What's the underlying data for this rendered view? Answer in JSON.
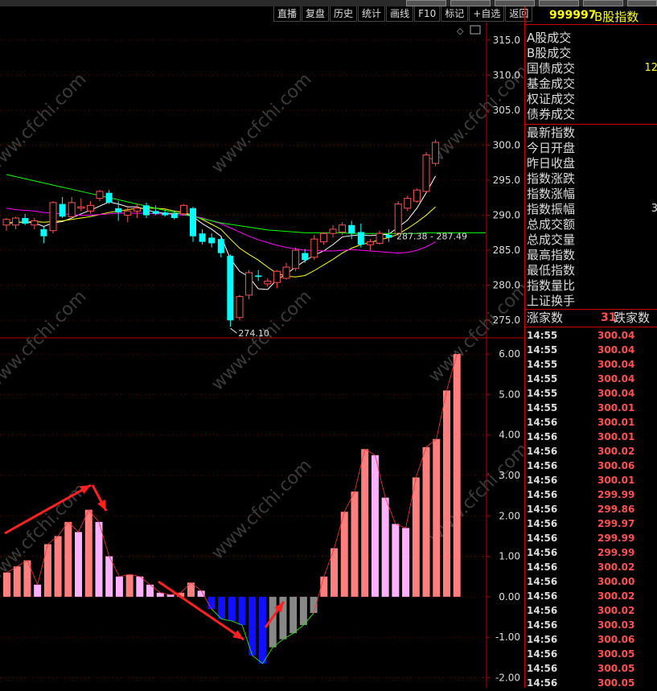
{
  "toolbar": {
    "buttons": [
      "直播",
      "复盘",
      "历史",
      "统计",
      "画线",
      "F10",
      "标记",
      "+自选",
      "返回"
    ]
  },
  "panel": {
    "code": "999997",
    "name": "B股指数",
    "volume_rows": [
      "A股成交",
      "B股成交",
      "国债成交",
      "基金成交",
      "权证成交",
      "债券成交"
    ],
    "volume_partial_values": [
      "",
      "",
      "12",
      "",
      "",
      ""
    ],
    "index_rows": [
      "最新指数",
      "今日开盘",
      "昨日收盘",
      "指数涨跌",
      "指数涨幅",
      "指数振幅",
      "总成交额",
      "总成交量",
      "最高指数",
      "最低指数",
      "指数量比",
      "上证换手"
    ],
    "index_partial_values": [
      "",
      "",
      "",
      "",
      "",
      "3",
      "",
      "",
      "",
      "",
      "",
      ""
    ],
    "up_label": "涨家数",
    "up_count": "31",
    "down_label": "跌家数",
    "ticks": [
      {
        "time": "14:55",
        "price": "300.04"
      },
      {
        "time": "14:55",
        "price": "300.04"
      },
      {
        "time": "14:55",
        "price": "300.04"
      },
      {
        "time": "14:55",
        "price": "300.04"
      },
      {
        "time": "14:55",
        "price": "300.04"
      },
      {
        "time": "14:55",
        "price": "300.01"
      },
      {
        "time": "14:56",
        "price": "300.01"
      },
      {
        "time": "14:56",
        "price": "300.01"
      },
      {
        "time": "14:56",
        "price": "300.02"
      },
      {
        "time": "14:56",
        "price": "300.06"
      },
      {
        "time": "14:56",
        "price": "300.01"
      },
      {
        "time": "14:56",
        "price": "299.99"
      },
      {
        "time": "14:56",
        "price": "299.86"
      },
      {
        "time": "14:56",
        "price": "299.97"
      },
      {
        "time": "14:56",
        "price": "299.99"
      },
      {
        "time": "14:56",
        "price": "299.99"
      },
      {
        "time": "14:56",
        "price": "300.02"
      },
      {
        "time": "14:56",
        "price": "300.00"
      },
      {
        "time": "14:56",
        "price": "300.02"
      },
      {
        "time": "14:56",
        "price": "300.02"
      },
      {
        "time": "14:56",
        "price": "300.03"
      },
      {
        "time": "14:56",
        "price": "300.06"
      },
      {
        "time": "14:56",
        "price": "300.05"
      },
      {
        "time": "14:56",
        "price": "300.05"
      },
      {
        "time": "14:56",
        "price": "300.05"
      }
    ]
  },
  "watermark": "www.cfchi.com",
  "colors": {
    "up": "#ff5050",
    "down": "#00ffff",
    "axis": "#c00000",
    "ma5": "#ffffff",
    "ma10": "#ffff00",
    "ma20": "#ff00ff",
    "ma60": "#00ff00"
  },
  "chart_data": [
    {
      "type": "candlestick",
      "ylim": [
        272.5,
        317.5
      ],
      "yticks": [
        "315.0",
        "310.0",
        "305.0",
        "300.0",
        "295.0",
        "290.0",
        "285.0",
        "280.0",
        "275.0"
      ],
      "annotations": {
        "low_label": "274.10",
        "range_label": "287.38 - 287.49"
      },
      "candles": [
        {
          "o": 288.6,
          "h": 289.6,
          "l": 287.8,
          "c": 289.4
        },
        {
          "o": 288.6,
          "h": 289.8,
          "l": 288.0,
          "c": 289.6
        },
        {
          "o": 289.6,
          "h": 290.2,
          "l": 288.6,
          "c": 288.8
        },
        {
          "o": 288.6,
          "h": 289.6,
          "l": 288.0,
          "c": 289.2
        },
        {
          "o": 288.0,
          "h": 288.4,
          "l": 286.0,
          "c": 287.0
        },
        {
          "o": 287.8,
          "h": 292.0,
          "l": 287.4,
          "c": 291.8
        },
        {
          "o": 291.6,
          "h": 292.6,
          "l": 289.6,
          "c": 289.8
        },
        {
          "o": 289.8,
          "h": 292.6,
          "l": 289.6,
          "c": 291.8
        },
        {
          "o": 291.0,
          "h": 292.4,
          "l": 290.6,
          "c": 291.2
        },
        {
          "o": 290.6,
          "h": 292.0,
          "l": 290.2,
          "c": 291.4
        },
        {
          "o": 292.4,
          "h": 293.6,
          "l": 292.0,
          "c": 293.4
        },
        {
          "o": 293.2,
          "h": 293.6,
          "l": 291.6,
          "c": 291.8
        },
        {
          "o": 291.0,
          "h": 292.0,
          "l": 289.2,
          "c": 290.4
        },
        {
          "o": 290.0,
          "h": 291.2,
          "l": 289.0,
          "c": 290.6
        },
        {
          "o": 290.6,
          "h": 291.6,
          "l": 289.6,
          "c": 291.0
        },
        {
          "o": 291.4,
          "h": 291.8,
          "l": 289.6,
          "c": 290.0
        },
        {
          "o": 290.6,
          "h": 291.4,
          "l": 290.0,
          "c": 290.2
        },
        {
          "o": 290.4,
          "h": 290.8,
          "l": 289.8,
          "c": 290.0
        },
        {
          "o": 290.2,
          "h": 290.6,
          "l": 289.4,
          "c": 289.6
        },
        {
          "o": 290.2,
          "h": 291.6,
          "l": 290.0,
          "c": 291.4
        },
        {
          "o": 291.0,
          "h": 291.2,
          "l": 286.2,
          "c": 287.0
        },
        {
          "o": 287.4,
          "h": 288.0,
          "l": 285.8,
          "c": 286.2
        },
        {
          "o": 286.8,
          "h": 287.4,
          "l": 285.4,
          "c": 286.0
        },
        {
          "o": 286.6,
          "h": 286.8,
          "l": 284.0,
          "c": 284.6
        },
        {
          "o": 284.2,
          "h": 284.4,
          "l": 274.1,
          "c": 275.0
        },
        {
          "o": 275.4,
          "h": 278.6,
          "l": 275.0,
          "c": 278.4
        },
        {
          "o": 278.6,
          "h": 282.2,
          "l": 278.0,
          "c": 281.8
        },
        {
          "o": 281.4,
          "h": 282.2,
          "l": 280.6,
          "c": 281.2
        },
        {
          "o": 280.2,
          "h": 281.0,
          "l": 279.8,
          "c": 280.6
        },
        {
          "o": 280.4,
          "h": 282.2,
          "l": 279.6,
          "c": 282.0
        },
        {
          "o": 281.0,
          "h": 283.2,
          "l": 280.8,
          "c": 282.6
        },
        {
          "o": 282.4,
          "h": 285.4,
          "l": 282.0,
          "c": 285.0
        },
        {
          "o": 284.6,
          "h": 285.2,
          "l": 283.2,
          "c": 283.6
        },
        {
          "o": 284.0,
          "h": 287.2,
          "l": 283.6,
          "c": 286.6
        },
        {
          "o": 286.2,
          "h": 287.6,
          "l": 285.8,
          "c": 287.4
        },
        {
          "o": 287.4,
          "h": 288.6,
          "l": 286.8,
          "c": 288.0
        },
        {
          "o": 287.6,
          "h": 289.0,
          "l": 287.2,
          "c": 288.6
        },
        {
          "o": 288.6,
          "h": 289.2,
          "l": 286.6,
          "c": 287.4
        },
        {
          "o": 287.6,
          "h": 288.8,
          "l": 285.4,
          "c": 285.8
        },
        {
          "o": 285.8,
          "h": 286.6,
          "l": 285.0,
          "c": 286.2
        },
        {
          "o": 286.0,
          "h": 287.8,
          "l": 285.8,
          "c": 287.4
        },
        {
          "o": 287.2,
          "h": 288.0,
          "l": 286.2,
          "c": 286.8
        },
        {
          "o": 287.4,
          "h": 292.0,
          "l": 287.0,
          "c": 291.6
        },
        {
          "o": 291.0,
          "h": 292.8,
          "l": 290.6,
          "c": 292.4
        },
        {
          "o": 292.0,
          "h": 293.8,
          "l": 291.8,
          "c": 293.6
        },
        {
          "o": 293.4,
          "h": 299.0,
          "l": 293.2,
          "c": 298.6
        },
        {
          "o": 297.4,
          "h": 300.8,
          "l": 297.0,
          "c": 300.4
        }
      ],
      "ma_series": [
        {
          "values": [
            288.8,
            289.0,
            289.0,
            288.9,
            288.4,
            288.9,
            289.1,
            289.6,
            290.2,
            290.7,
            291.3,
            291.9,
            291.6,
            291.2,
            291.2,
            290.8,
            290.4,
            290.3,
            290.2,
            290.3,
            289.8,
            288.8,
            288.0,
            287.0,
            283.8,
            282.0,
            281.2,
            279.5,
            279.4,
            280.8,
            281.6,
            282.6,
            283.5,
            284.3,
            284.9,
            285.8,
            286.9,
            287.1,
            287.2,
            287.1,
            287.2,
            287.3,
            288.3,
            289.3,
            291.0,
            293.2,
            295.6
          ]
        },
        {
          "values": [
            288.9,
            289.0,
            289.0,
            289.1,
            289.0,
            289.1,
            289.2,
            289.4,
            289.6,
            289.8,
            290.1,
            290.4,
            290.6,
            290.8,
            291.0,
            291.0,
            291.0,
            290.9,
            290.6,
            290.4,
            290.0,
            289.4,
            288.7,
            288.0,
            286.6,
            285.3,
            284.4,
            283.6,
            282.6,
            281.7,
            281.3,
            281.2,
            281.4,
            282.1,
            282.9,
            283.7,
            284.6,
            285.3,
            285.8,
            286.1,
            286.5,
            286.8,
            287.3,
            288.1,
            289.0,
            290.0,
            291.2
          ]
        },
        {
          "values": [
            291.0,
            290.8,
            290.7,
            290.6,
            290.4,
            290.3,
            290.2,
            290.1,
            290.0,
            290.0,
            290.1,
            290.2,
            290.3,
            290.3,
            290.3,
            290.3,
            290.2,
            290.2,
            290.1,
            290.0,
            289.9,
            289.6,
            289.2,
            288.8,
            288.2,
            287.6,
            287.0,
            286.5,
            286.1,
            285.7,
            285.4,
            285.2,
            285.0,
            285.0,
            284.9,
            284.9,
            285.0,
            285.1,
            285.0,
            284.9,
            284.8,
            284.7,
            284.6,
            284.7,
            285.0,
            285.5,
            286.2
          ]
        },
        {
          "values": [
            295.8,
            295.5,
            295.2,
            294.9,
            294.6,
            294.3,
            294.0,
            293.7,
            293.4,
            293.1,
            292.8,
            292.5,
            292.2,
            291.9,
            291.6,
            291.3,
            291.0,
            290.7,
            290.4,
            290.1,
            289.8,
            289.5,
            289.2,
            288.9,
            288.7,
            288.5,
            288.3,
            288.1,
            287.9,
            287.8,
            287.7,
            287.6,
            287.5,
            287.5,
            287.5,
            287.5,
            287.5,
            287.4,
            287.4,
            287.4,
            287.4,
            287.4,
            287.4,
            287.4,
            287.4,
            287.5,
            287.5
          ]
        }
      ]
    },
    {
      "type": "bar",
      "ylim": [
        -2.25,
        6.4
      ],
      "yticks": [
        "6.00",
        "5.00",
        "4.00",
        "3.00",
        "2.00",
        "1.00",
        "0.00",
        "-1.00",
        "-2.00"
      ],
      "values": [
        0.6,
        0.75,
        0.9,
        0.3,
        1.3,
        1.5,
        1.85,
        1.6,
        2.15,
        1.85,
        1.0,
        0.5,
        0.55,
        0.5,
        0.3,
        0.1,
        0.05,
        0.1,
        0.35,
        0.15,
        -0.3,
        -0.55,
        -0.6,
        -0.7,
        -1.45,
        -1.65,
        -1.25,
        -1.05,
        -0.9,
        -0.7,
        -0.4,
        0.5,
        1.2,
        2.1,
        2.6,
        3.65,
        3.5,
        2.45,
        1.8,
        1.7,
        2.95,
        3.7,
        3.9,
        5.1,
        6.0
      ]
    }
  ]
}
